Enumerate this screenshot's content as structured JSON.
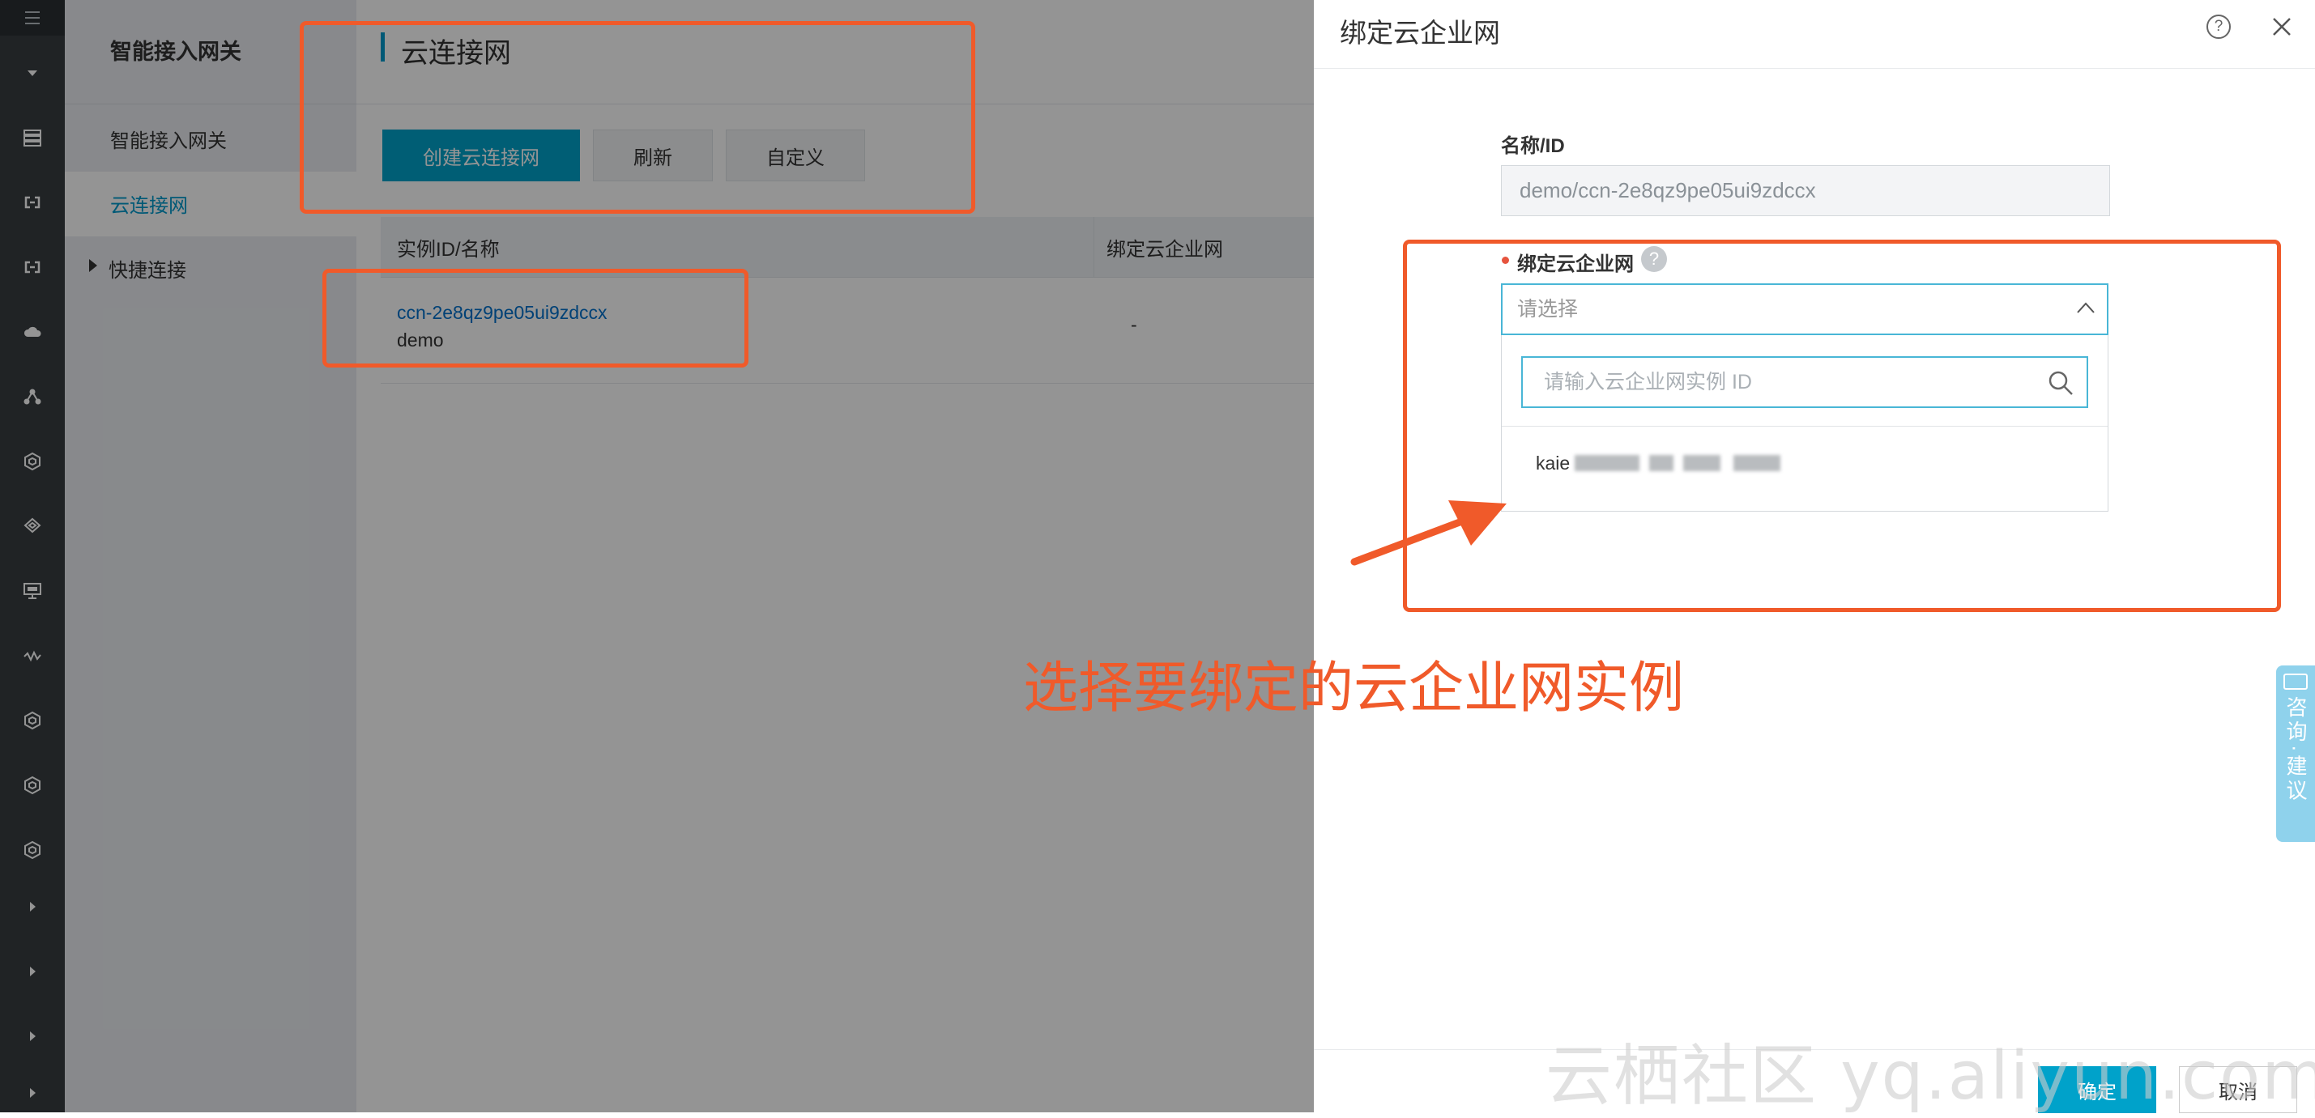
{
  "sidebar": {
    "title": "智能接入网关",
    "items": [
      {
        "label": "智能接入网关"
      },
      {
        "label": "云连接网"
      },
      {
        "label": "快捷连接"
      }
    ]
  },
  "main": {
    "title": "云连接网",
    "buttons": {
      "create": "创建云连接网",
      "refresh": "刷新",
      "customize": "自定义"
    },
    "table": {
      "columns": [
        "实例ID/名称",
        "绑定云企业网"
      ],
      "rows": [
        {
          "id": "ccn-2e8qz9pe05ui9zdccx",
          "name": "demo",
          "bound_cen": "-"
        }
      ]
    }
  },
  "drawer": {
    "title": "绑定云企业网",
    "help_glyph": "?",
    "name_label": "名称/ID",
    "name_value": "demo/ccn-2e8qz9pe05ui9zdccx",
    "bind_label": "绑定云企业网",
    "bind_help_glyph": "?",
    "select_placeholder": "请选择",
    "search_placeholder": "请输入云企业网实例 ID",
    "options": [
      {
        "label": "kaie"
      }
    ],
    "ok_label": "确定",
    "cancel_label": "取消"
  },
  "annotation": {
    "text": "选择要绑定的云企业网实例"
  },
  "watermark": "云栖社区 yq.aliyun.com",
  "float_tab": {
    "label": "咨询·建议"
  },
  "colors": {
    "highlight": "#f05a2a",
    "accent": "#00a2ca",
    "rail": "#373d41"
  }
}
